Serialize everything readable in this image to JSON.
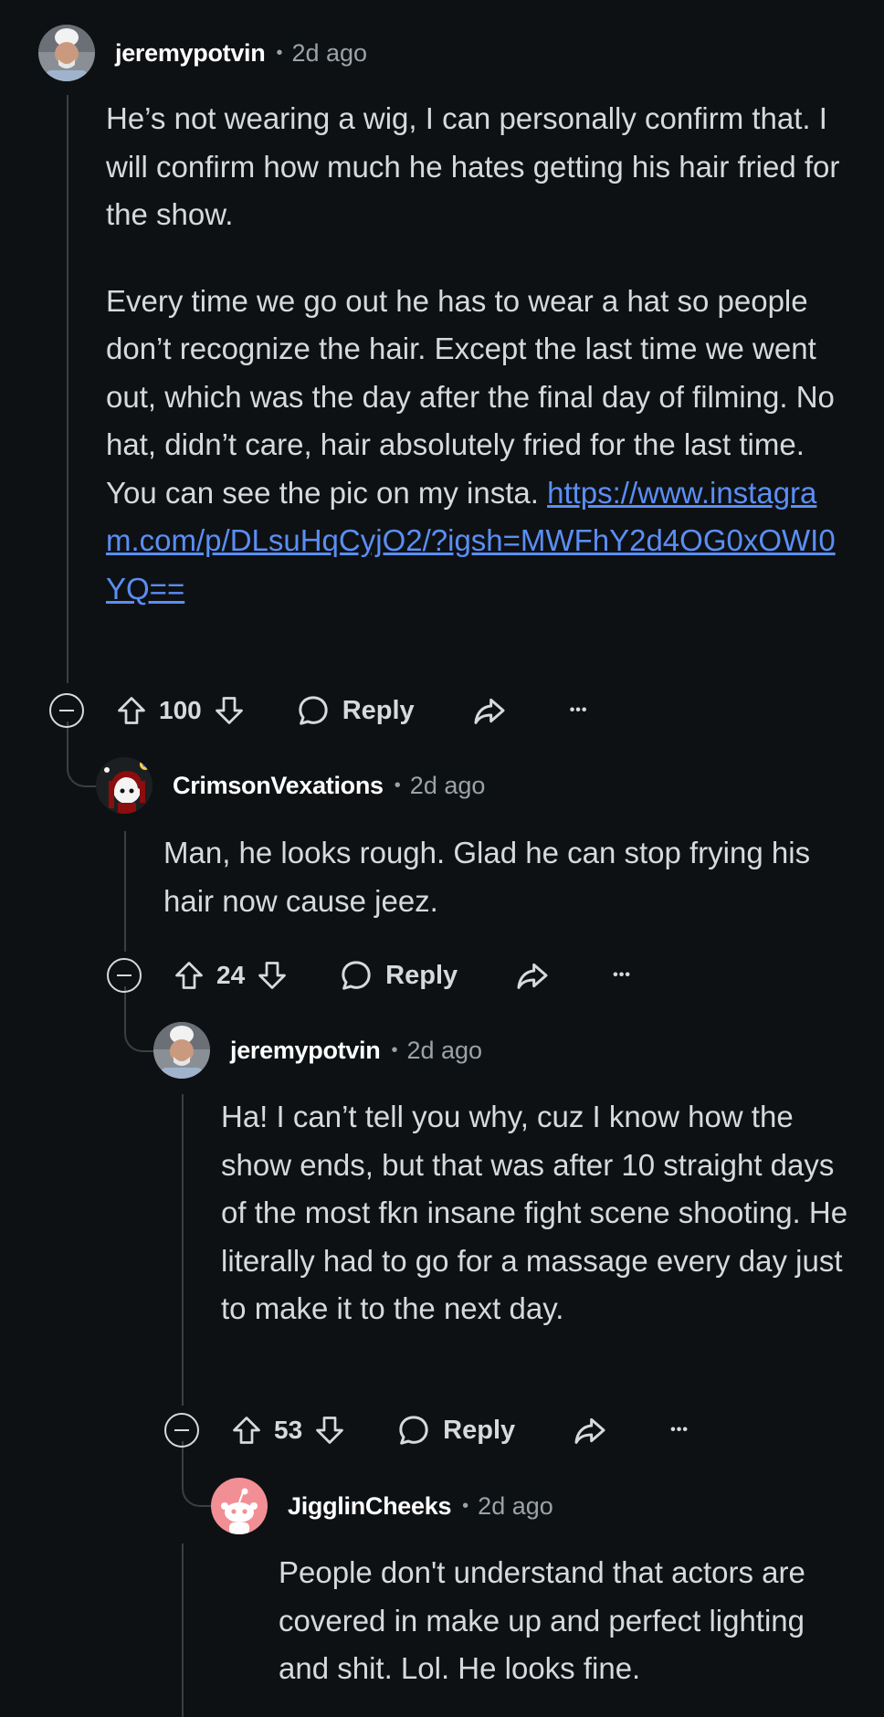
{
  "comments": [
    {
      "username": "jeremypotvin",
      "time": "2d ago",
      "paragraphs": [
        "He’s not wearing a wig, I can personally confirm that. I will confirm how much he hates getting his hair fried for the show.",
        "Every time we go out he has to wear a hat so people don’t recognize the hair. Except the last time we went out, which was the day after the final day of filming. No hat, didn’t care, hair absolutely fried for the last time. You can see the pic on my insta."
      ],
      "link": "https://www.instagram.com/p/DLsuHqCyjO2/?igsh=MWFhY2d4OG0xOWI0YQ==",
      "score": "100",
      "reply_label": "Reply",
      "more_label": "•••"
    },
    {
      "username": "CrimsonVexations",
      "time": "2d ago",
      "paragraphs": [
        "Man, he looks rough. Glad he can stop frying his hair now cause jeez."
      ],
      "score": "24",
      "reply_label": "Reply",
      "more_label": "•••"
    },
    {
      "username": "jeremypotvin",
      "time": "2d ago",
      "paragraphs": [
        "Ha! I can’t tell you why, cuz I know how the show ends, but that was after 10 straight days of the most fkn insane fight scene shooting. He literally had to go for a massage every day just to make it to the next day."
      ],
      "score": "53",
      "reply_label": "Reply",
      "more_label": "•••"
    },
    {
      "username": "JigglinCheeks",
      "time": "2d ago",
      "paragraphs": [
        "People don't understand that actors are covered in make up and perfect lighting and shit. Lol. He looks fine."
      ]
    }
  ],
  "separator": "•",
  "colors": {
    "background": "#0e1113",
    "text": "#d7dadc",
    "link": "#5b8ef5",
    "meta": "#9aa3a8",
    "thread_line": "#3a3f43"
  },
  "icons": {
    "collapse": "minus-circle-icon",
    "upvote": "arrow-up-icon",
    "downvote": "arrow-down-icon",
    "reply": "speech-bubble-icon",
    "share": "share-arrow-icon",
    "more": "ellipsis-icon"
  }
}
